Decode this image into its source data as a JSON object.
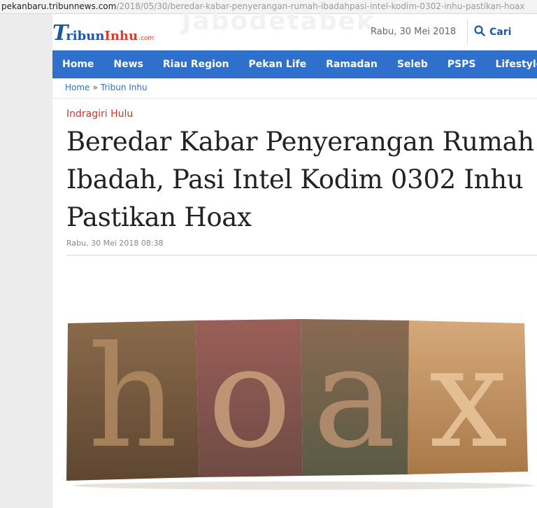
{
  "browser": {
    "url_host": "pekanbaru.tribunnews.com",
    "url_path": "/2018/05/30/beredar-kabar-penyerangan-rumah-ibadahpasi-intel-kodim-0302-inhu-pastikan-hoax"
  },
  "header": {
    "logo_initial": "T",
    "logo_word1": "ribun",
    "logo_word2": "Inhu",
    "logo_domain": ".com",
    "watermark": "Jabodetabek",
    "date": "Rabu, 30 Mei 2018",
    "search_label": "Cari",
    "search_icon": "search-icon"
  },
  "nav": {
    "items": [
      "Home",
      "News",
      "Riau Region",
      "Pekan Life",
      "Ramadan",
      "Seleb",
      "PSPS",
      "Lifestyle"
    ]
  },
  "breadcrumb": {
    "home": "Home",
    "separator": "»",
    "current": "Tribun Inhu"
  },
  "article": {
    "category": "Indragiri Hulu",
    "title": "Beredar Kabar Penyerangan Rumah Ibadah, Pasi Intel Kodim 0302 Inhu Pastikan Hoax",
    "date": "Rabu, 30 Mei 2018 08:38",
    "image_letters": [
      "h",
      "o",
      "a",
      "x"
    ]
  },
  "colors": {
    "nav_bg": "#2f70cd",
    "category": "#c8372d",
    "link": "#2f70cd",
    "logo_blue": "#1f55a8",
    "logo_red": "#e03b2a"
  }
}
